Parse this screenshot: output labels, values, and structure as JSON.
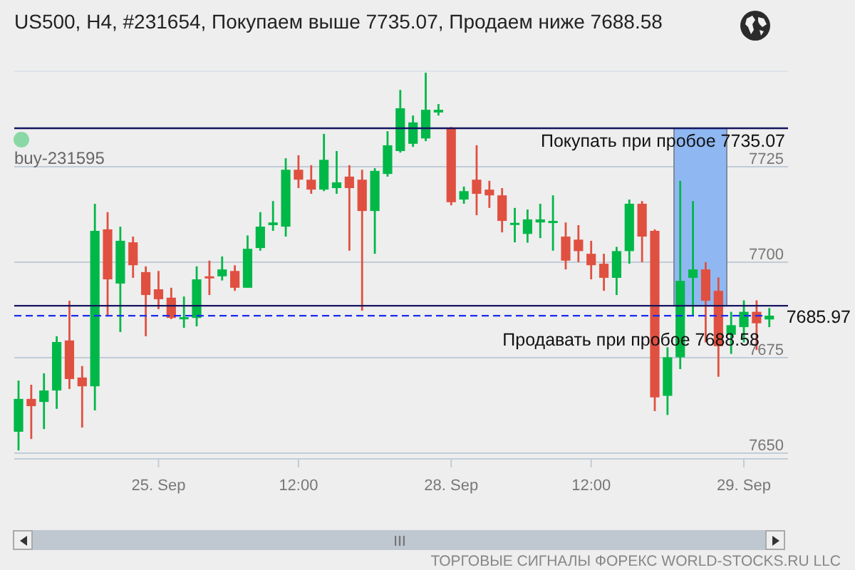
{
  "header": {
    "title": "US500, H4, #231654, Покупаем выше 7735.07, Продаем ниже 7688.58"
  },
  "chart": {
    "chart_data": {
      "type": "candlestick",
      "grid": true,
      "ylim": [
        7648.5,
        7750
      ],
      "yticks": [
        7650,
        7675,
        7700,
        7725
      ],
      "ref_lines": [
        {
          "axis": "y",
          "value": 7735.07,
          "label": "Покупать при пробое 7735.07"
        },
        {
          "axis": "y",
          "value": 7688.58,
          "label": "Продавать при пробое 7688.58"
        },
        {
          "axis": "y",
          "value": 7685.97,
          "label": "7685.97"
        }
      ],
      "categories": [
        null,
        null,
        null,
        null,
        null,
        null,
        null,
        null,
        null,
        null,
        null,
        "25. Sep",
        null,
        null,
        null,
        null,
        null,
        null,
        null,
        null,
        null,
        null,
        "12:00",
        null,
        null,
        null,
        null,
        null,
        null,
        null,
        null,
        null,
        null,
        null,
        "28. Sep",
        null,
        null,
        null,
        null,
        null,
        null,
        null,
        null,
        null,
        null,
        "12:00",
        null,
        null,
        null,
        null,
        null,
        null,
        null,
        null,
        null,
        null,
        null,
        "29. Sep",
        null,
        null
      ],
      "ohlc": [
        [
          7655.6,
          7669.0,
          7650.7,
          7664.2
        ],
        [
          7664.2,
          7667.9,
          7653.7,
          7662.3
        ],
        [
          7663.4,
          7670.9,
          7656.3,
          7666.4
        ],
        [
          7666.4,
          7680.6,
          7661.6,
          7679.1
        ],
        [
          7679.5,
          7689.9,
          7666.8,
          7669.4
        ],
        [
          7669.8,
          7672.8,
          7656.7,
          7667.5
        ],
        [
          7667.5,
          7715.3,
          7661.2,
          7708.2
        ],
        [
          7708.6,
          7713.1,
          7685.8,
          7695.5
        ],
        [
          7694.4,
          7709.3,
          7681.7,
          7705.6
        ],
        [
          7705.2,
          7706.7,
          7695.9,
          7699.2
        ],
        [
          7697.4,
          7698.9,
          7680.6,
          7691.4
        ],
        [
          7692.9,
          7697.7,
          7687.7,
          7690.3
        ],
        [
          7690.7,
          7693.3,
          7685.1,
          7685.4
        ],
        [
          7685.4,
          7691.0,
          7682.8,
          7685.6
        ],
        [
          7685.4,
          7698.9,
          7683.2,
          7695.5
        ],
        [
          7696.3,
          7700.4,
          7691.4,
          7695.9
        ],
        [
          7696.3,
          7701.5,
          7695.2,
          7698.1
        ],
        [
          7697.7,
          7699.2,
          7692.5,
          7693.3
        ],
        [
          7693.3,
          7707.0,
          7693.3,
          7703.5
        ],
        [
          7703.7,
          7713.1,
          7703.0,
          7709.3
        ],
        [
          7709.7,
          7716.0,
          7708.2,
          7710.4
        ],
        [
          7709.3,
          7727.2,
          7706.7,
          7724.2
        ],
        [
          7724.2,
          7728.0,
          7719.4,
          7721.6
        ],
        [
          7721.6,
          7725.4,
          7717.9,
          7719.0
        ],
        [
          7719.0,
          7733.6,
          7718.6,
          7726.8
        ],
        [
          7719.4,
          7729.1,
          7717.9,
          7720.9
        ],
        [
          7722.4,
          7725.4,
          7703.0,
          7719.4
        ],
        [
          7721.6,
          7724.2,
          7687.3,
          7713.4
        ],
        [
          7713.4,
          7724.6,
          7702.2,
          7723.9
        ],
        [
          7723.1,
          7734.3,
          7722.4,
          7730.6
        ],
        [
          7729.1,
          7745.1,
          7728.7,
          7740.3
        ],
        [
          7731.0,
          7738.4,
          7730.2,
          7736.6
        ],
        [
          7732.4,
          7749.6,
          7731.7,
          7739.9
        ],
        [
          7739.2,
          7741.4,
          7738.4,
          7739.9
        ],
        [
          7735.1,
          7735.4,
          7714.9,
          7715.7
        ],
        [
          7716.4,
          7719.8,
          7715.3,
          7718.6
        ],
        [
          7721.6,
          7730.6,
          7712.3,
          7717.9
        ],
        [
          7719.0,
          7721.3,
          7714.2,
          7717.5
        ],
        [
          7717.5,
          7719.4,
          7707.8,
          7710.8
        ],
        [
          7710.0,
          7714.2,
          7705.2,
          7710.3
        ],
        [
          7707.4,
          7713.8,
          7705.1,
          7711.2
        ],
        [
          7710.4,
          7715.3,
          7706.3,
          7711.2
        ],
        [
          7710.4,
          7717.5,
          7703.0,
          7710.8
        ],
        [
          7706.7,
          7710.4,
          7698.1,
          7700.4
        ],
        [
          7705.9,
          7709.7,
          7700.0,
          7702.9
        ],
        [
          7702.2,
          7705.6,
          7695.5,
          7699.2
        ],
        [
          7699.6,
          7702.2,
          7692.5,
          7695.9
        ],
        [
          7695.9,
          7704.0,
          7691.4,
          7702.9
        ],
        [
          7702.9,
          7716.4,
          7699.6,
          7715.3
        ],
        [
          7715.3,
          7716.0,
          7700.0,
          7706.7
        ],
        [
          7708.2,
          7708.6,
          7661.0,
          7664.6
        ],
        [
          7665.0,
          7677.7,
          7660.0,
          7675.1
        ],
        [
          7675.1,
          7721.3,
          7672.0,
          7695.1
        ],
        [
          7695.9,
          7716.0,
          7686.0,
          7698.1
        ],
        [
          7698.1,
          7700.0,
          7679.0,
          7689.9
        ],
        [
          7692.5,
          7696.0,
          7670.0,
          7678.0
        ],
        [
          7681.0,
          7687.0,
          7676.0,
          7683.5
        ],
        [
          7683.0,
          7690.0,
          7679.0,
          7687.0
        ],
        [
          7687.0,
          7690.0,
          7677.0,
          7684.0
        ],
        [
          7685.0,
          7688.0,
          7683.0,
          7686.0
        ]
      ]
    },
    "marker": {
      "label": "buy-231595"
    }
  },
  "footer": {
    "text": "ТОРГОВЫЕ СИГНАЛЫ ФОРЕКС WORLD-STOCKS.RU LLC"
  }
}
